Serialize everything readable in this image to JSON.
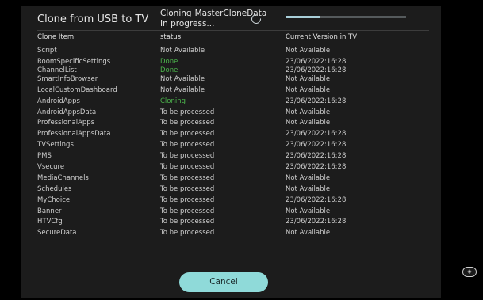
{
  "dialog": {
    "title": "Clone from USB to TV"
  },
  "cloning": {
    "label": "Cloning",
    "name": "MasterCloneData",
    "status": "In progress..."
  },
  "progress": {
    "fraction": 0.28,
    "color": "#a9cfd9"
  },
  "table": {
    "headers": [
      "Clone Item",
      "status",
      "Current Version in TV"
    ],
    "rows": [
      {
        "item": "Script",
        "status": "Not Available",
        "status_type": "normal",
        "version": "Not Available"
      },
      {
        "item": "RoomSpecificSettings",
        "status": "Done",
        "status_type": "done",
        "version": "23/06/2022:16:28"
      },
      {
        "item": "ChannelList",
        "status": "Done",
        "status_type": "done",
        "version": "23/06/2022:16:28"
      },
      {
        "item": "SmartInfoBrowser",
        "status": "Not Available",
        "status_type": "normal",
        "version": "Not Available"
      },
      {
        "item": "LocalCustomDashboard",
        "status": "Not Available",
        "status_type": "normal",
        "version": "Not Available"
      },
      {
        "item": "AndroidApps",
        "status": "Cloning",
        "status_type": "cloning",
        "version": "23/06/2022:16:28"
      },
      {
        "item": "AndroidAppsData",
        "status": "To be processed",
        "status_type": "normal",
        "version": "Not Available"
      },
      {
        "item": "ProfessionalApps",
        "status": "To be processed",
        "status_type": "normal",
        "version": "Not Available"
      },
      {
        "item": "ProfessionalAppsData",
        "status": "To be processed",
        "status_type": "normal",
        "version": "23/06/2022:16:28"
      },
      {
        "item": "TVSettings",
        "status": "To be processed",
        "status_type": "normal",
        "version": "23/06/2022:16:28"
      },
      {
        "item": "PMS",
        "status": "To be processed",
        "status_type": "normal",
        "version": "23/06/2022:16:28"
      },
      {
        "item": "Vsecure",
        "status": "To be processed",
        "status_type": "normal",
        "version": "23/06/2022:16:28"
      },
      {
        "item": "MediaChannels",
        "status": "To be processed",
        "status_type": "normal",
        "version": "Not Available"
      },
      {
        "item": "Schedules",
        "status": "To be processed",
        "status_type": "normal",
        "version": "Not Available"
      },
      {
        "item": "MyChoice",
        "status": "To be processed",
        "status_type": "normal",
        "version": "23/06/2022:16:28"
      },
      {
        "item": "Banner",
        "status": "To be processed",
        "status_type": "normal",
        "version": "Not Available"
      },
      {
        "item": "HTVCfg",
        "status": "To be processed",
        "status_type": "normal",
        "version": "23/06/2022:16:28"
      },
      {
        "item": "SecureData",
        "status": "To be processed",
        "status_type": "normal",
        "version": "Not Available"
      }
    ]
  },
  "buttons": {
    "cancel_label": "Cancel"
  },
  "side_button": {
    "icon": "remote-control-icon"
  },
  "colors": {
    "done": "#4cb54c",
    "accent_button": "#8fdad9"
  }
}
